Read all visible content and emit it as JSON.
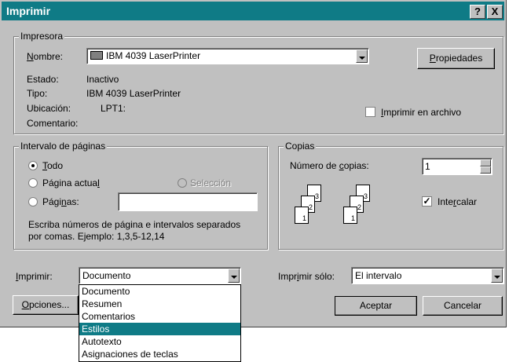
{
  "dialog": {
    "title": "Imprimir",
    "help_glyph": "?",
    "close_glyph": "X"
  },
  "printer": {
    "group_label": "Impresora",
    "name_label": "Nombre:",
    "name_value": "IBM 4039 LaserPrinter",
    "properties_button": "Propiedades",
    "status_label": "Estado:",
    "status_value": "Inactivo",
    "type_label": "Tipo:",
    "type_value": "IBM 4039 LaserPrinter",
    "location_label": "Ubicación:",
    "location_value": "LPT1:",
    "comment_label": "Comentario:",
    "print_to_file_label": "Imprimir en archivo"
  },
  "range": {
    "group_label": "Intervalo de páginas",
    "all_label": "Todo",
    "current_label": "Página actual",
    "selection_label": "Selección",
    "pages_label": "Páginas:",
    "pages_value": "",
    "help_line1": "Escriba números de página e intervalos separados",
    "help_line2": "por comas. Ejemplo: 1,3,5-12,14"
  },
  "copies": {
    "group_label": "Copias",
    "count_label": "Número de copias:",
    "count_value": "1",
    "collate_label": "Intercalar",
    "page_numbers": [
      "3",
      "2",
      "1"
    ]
  },
  "bottom": {
    "print_label": "Imprimir:",
    "print_value": "Documento",
    "print_only_label": "Imprimir sólo:",
    "print_only_value": "El intervalo",
    "options_button": "Opciones...",
    "accept_button": "Aceptar",
    "cancel_button": "Cancelar"
  },
  "print_dropdown": {
    "items": [
      "Documento",
      "Resumen",
      "Comentarios",
      "Estilos",
      "Autotexto",
      "Asignaciones de teclas"
    ],
    "selected": "Estilos"
  }
}
